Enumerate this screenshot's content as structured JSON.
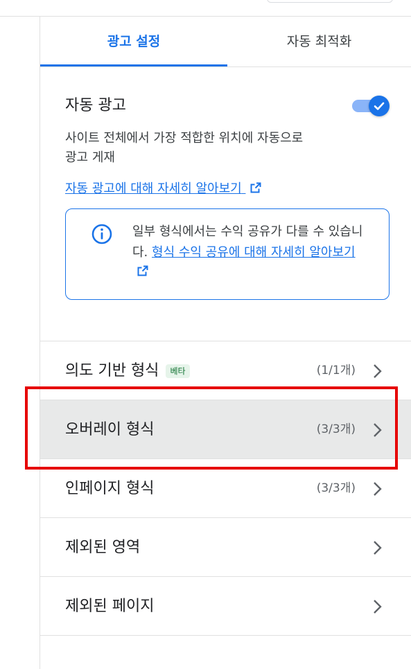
{
  "tabs": [
    {
      "label": "광고 설정",
      "active": true
    },
    {
      "label": "자동 최적화",
      "active": false
    }
  ],
  "auto_ads": {
    "title": "자동 광고",
    "enabled": true,
    "description": "사이트 전체에서 가장 적합한 위치에 자동으로 광고 게재",
    "learn_more": "자동 광고에 대해 자세히 알아보기"
  },
  "info": {
    "text": "일부 형식에서는 수익 공유가 다를 수 있습니다.",
    "link": "형식 수익 공유에 대해 자세히 알아보기"
  },
  "format_rows": [
    {
      "label": "의도 기반 형식",
      "badge": "베타",
      "count": "(1/1개)",
      "selected": false
    },
    {
      "label": "오버레이 형식",
      "badge": "",
      "count": "(3/3개)",
      "selected": true
    },
    {
      "label": "인페이지 형식",
      "badge": "",
      "count": "(3/3개)",
      "selected": false
    },
    {
      "label": "제외된 영역",
      "badge": "",
      "count": "",
      "selected": false
    },
    {
      "label": "제외된 페이지",
      "badge": "",
      "count": "",
      "selected": false
    }
  ],
  "colors": {
    "accent": "#1a73e8",
    "selected_row": "#e8e9e9",
    "annotation": "#e60000",
    "beta_bg": "#e6f4ea",
    "beta_text": "#137333"
  },
  "icons": {
    "toggle": "check-icon",
    "info": "info-icon",
    "external": "external-link-icon",
    "row_chevron": "chevron-right-icon"
  }
}
